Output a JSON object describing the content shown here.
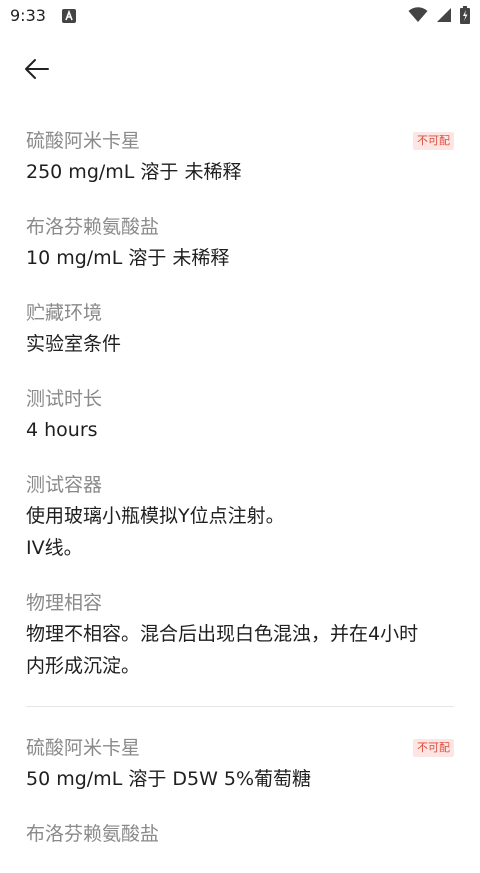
{
  "status_bar": {
    "time": "9:33",
    "icons": [
      "notification-app-icon",
      "wifi-icon",
      "cell-signal-icon",
      "battery-icon"
    ]
  },
  "nav": {
    "back_icon": "arrow-left-icon"
  },
  "records": [
    {
      "badge": "不可配",
      "fields": [
        {
          "label": "硫酸阿米卡星",
          "value": "250 mg/mL 溶于 未稀释"
        },
        {
          "label": "布洛芬赖氨酸盐",
          "value": "10 mg/mL 溶于 未稀释"
        },
        {
          "label": "贮藏环境",
          "value": "实验室条件"
        },
        {
          "label": "测试时长",
          "value": "4 hours"
        },
        {
          "label": "测试容器",
          "value": "使用玻璃小瓶模拟Y位点注射。\nIV线。"
        },
        {
          "label": "物理相容",
          "value": "物理不相容。混合后出现白色混浊，并在4小时\n内形成沉淀。"
        }
      ]
    },
    {
      "badge": "不可配",
      "fields": [
        {
          "label": "硫酸阿米卡星",
          "value": "50 mg/mL 溶于 D5W 5%葡萄糖"
        },
        {
          "label": "布洛芬赖氨酸盐",
          "value": ""
        }
      ]
    }
  ]
}
